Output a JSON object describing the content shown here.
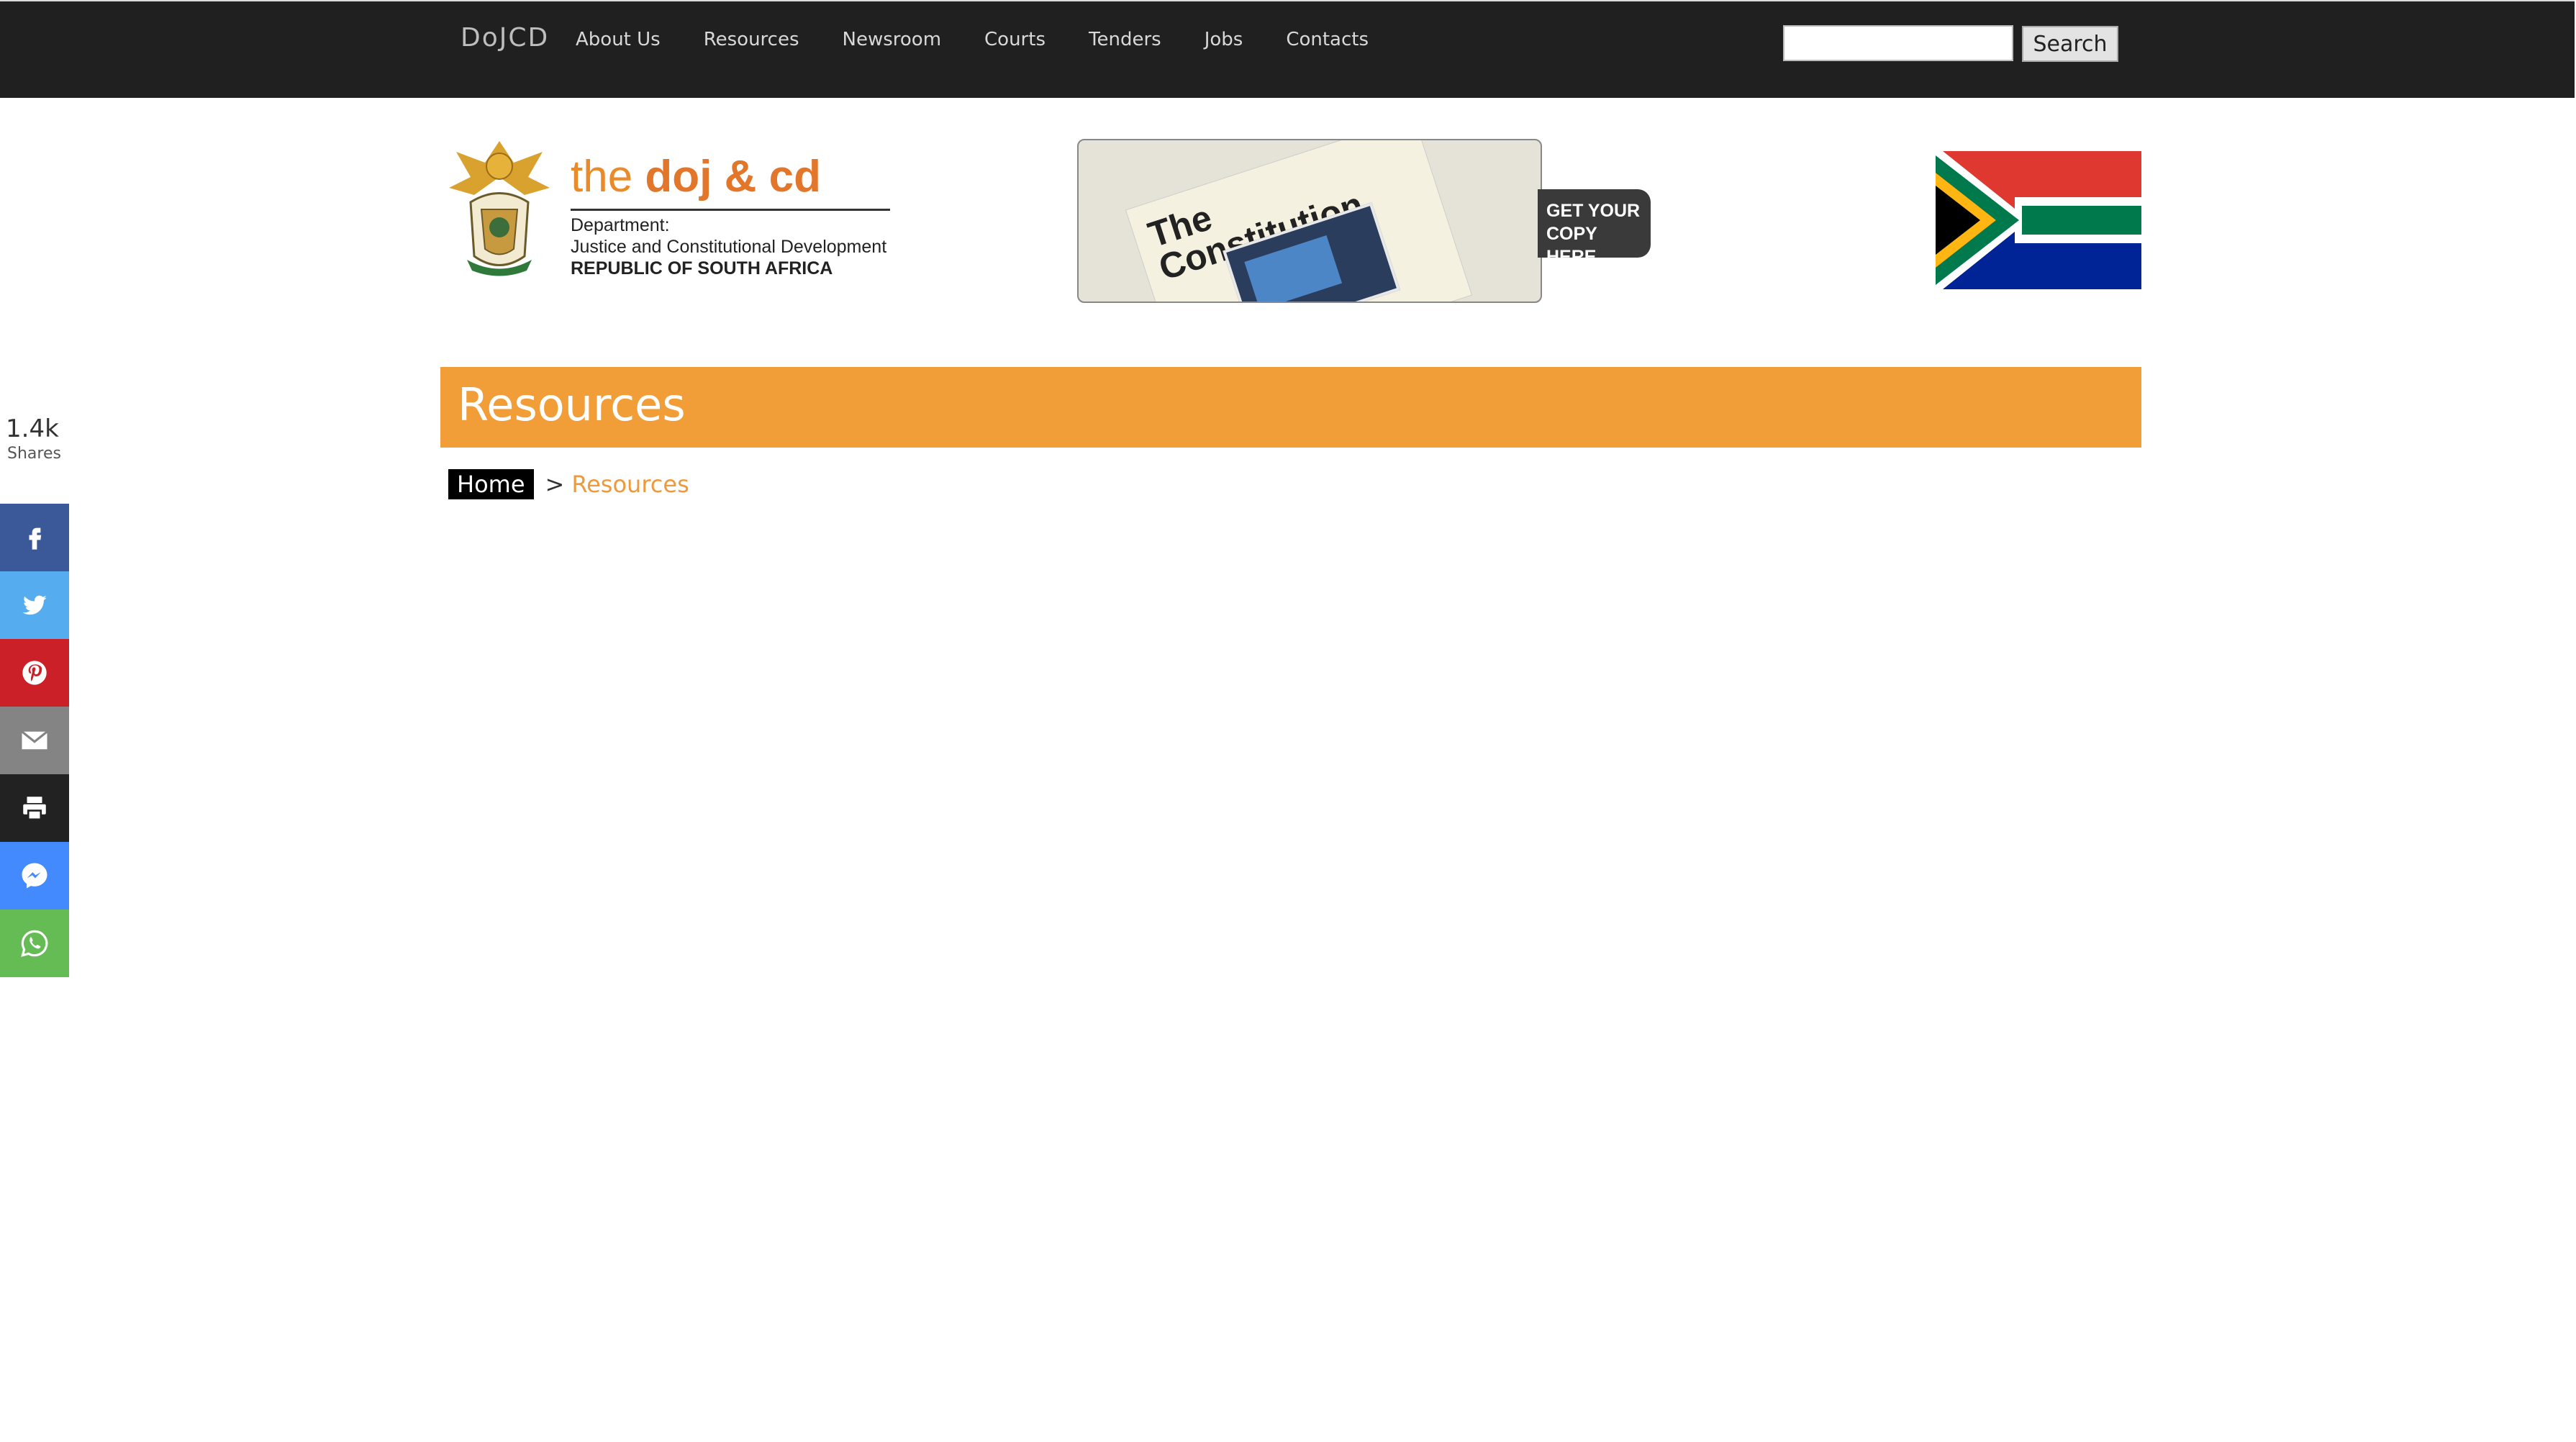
{
  "nav": {
    "brand": "DoJCD",
    "items": [
      "About Us",
      "Resources",
      "Newsroom",
      "Courts",
      "Tenders",
      "Jobs",
      "Contacts"
    ],
    "search_value": "",
    "search_button": "Search"
  },
  "header": {
    "logo_the": "the ",
    "logo_doj": "doj & cd",
    "logo_dept": "Department:",
    "logo_dept_name": "Justice and Constitutional Development",
    "logo_country": "REPUBLIC OF SOUTH AFRICA",
    "banner_title_1": "The",
    "banner_title_2": "Constitution",
    "banner_cta_1": "GET YOUR",
    "banner_cta_2": "COPY HERE"
  },
  "page": {
    "title": "Resources",
    "breadcrumb_home": "Home",
    "breadcrumb_sep": ">",
    "breadcrumb_current": "Resources"
  },
  "share": {
    "count": "1.4k",
    "label": "Shares",
    "buttons": [
      {
        "icon": "facebook-icon",
        "color": "#3b5998"
      },
      {
        "icon": "twitter-icon",
        "color": "#55acee"
      },
      {
        "icon": "pinterest-icon",
        "color": "#cb2027"
      },
      {
        "icon": "email-icon",
        "color": "#848484"
      },
      {
        "icon": "print-icon",
        "color": "#222222"
      },
      {
        "icon": "messenger-icon",
        "color": "#448aff"
      },
      {
        "icon": "whatsapp-icon",
        "color": "#65bc54"
      }
    ]
  },
  "colors": {
    "topbar": "#202020",
    "accent": "#f29e38",
    "breadcrumb_current": "#ec9a3c"
  }
}
